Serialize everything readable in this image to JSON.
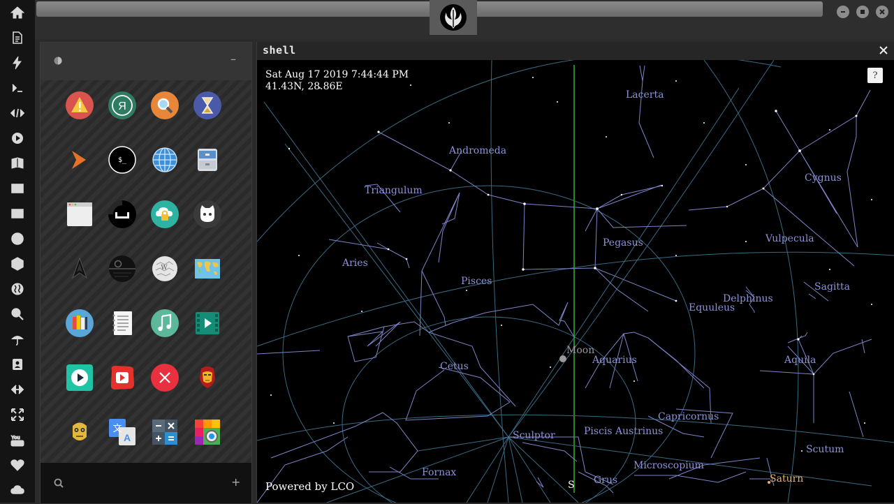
{
  "dock": {
    "items": [
      {
        "name": "home-icon"
      },
      {
        "name": "document-icon"
      },
      {
        "name": "lightning-icon"
      },
      {
        "name": "terminal-icon"
      },
      {
        "name": "code-icon"
      },
      {
        "name": "play-icon"
      },
      {
        "name": "book-icon"
      },
      {
        "name": "image-icon"
      },
      {
        "name": "newspaper-icon"
      },
      {
        "name": "rebel-alliance-icon"
      },
      {
        "name": "hexagon-icon"
      },
      {
        "name": "globe-icon"
      },
      {
        "name": "search-icon"
      },
      {
        "name": "umbrella-icon"
      },
      {
        "name": "contact-card-icon"
      },
      {
        "name": "code-fork-icon"
      },
      {
        "name": "fullscreen-icon"
      },
      {
        "name": "youtube-icon"
      },
      {
        "name": "heart-icon"
      },
      {
        "name": "cloud-icon"
      }
    ]
  },
  "window_controls": [
    "minimize-icon",
    "maximize-icon",
    "close-icon"
  ],
  "launcher": {
    "header_toggle_icon": "contrast-icon",
    "header_minimize": "–",
    "footer_add": "+",
    "apps": [
      [
        "warning-app-icon",
        "yandex-app-icon",
        "magnifier-app-icon",
        "hourglass-app-icon"
      ],
      [
        "chevron-app-icon",
        "terminal-app-icon",
        "globe-app-icon",
        "file-cabinet-app-icon"
      ],
      [
        "window-app-icon",
        "yoke-app-icon",
        "cloud-lock-app-icon",
        "github-app-icon"
      ],
      [
        "starfleet-app-icon",
        "death-star-app-icon",
        "wikipedia-app-icon",
        "world-map-app-icon"
      ],
      [
        "library-app-icon",
        "notes-app-icon",
        "music-app-icon",
        "video-app-icon"
      ],
      [
        "player-app-icon",
        "youtube-app-icon",
        "close-circle-app-icon",
        "iron-man-app-icon"
      ],
      [
        "c3po-app-icon",
        "translate-app-icon",
        "calculator-app-icon",
        "photo-app-icon"
      ]
    ]
  },
  "shell": {
    "title": "shell",
    "close": "x",
    "datetime": "Sat Aug 17 2019 7:44:44 PM",
    "location": "41.43N, 28.86E",
    "help": "?",
    "credit": "Powered by LCO",
    "constellations": [
      "Lacerta",
      "Andromeda",
      "Cygnus",
      "Triangulum",
      "Vulpecula",
      "Pegasus",
      "Aries",
      "Pisces",
      "Sagitta",
      "Delphinus",
      "Equuleus",
      "Moon",
      "Aquarius",
      "Cetus",
      "Aquila",
      "Capricornus",
      "Piscis Austrinus",
      "Sculptor",
      "Scutum",
      "Microscopium",
      "Fornax",
      "Grus",
      "Saturn",
      "S"
    ],
    "colors": {
      "constellation": "#8e92d8",
      "lines": "#7d85c8",
      "grid": "#4e8fb0",
      "meridian": "#1f8a1f",
      "planet": "#e8b46a"
    }
  }
}
